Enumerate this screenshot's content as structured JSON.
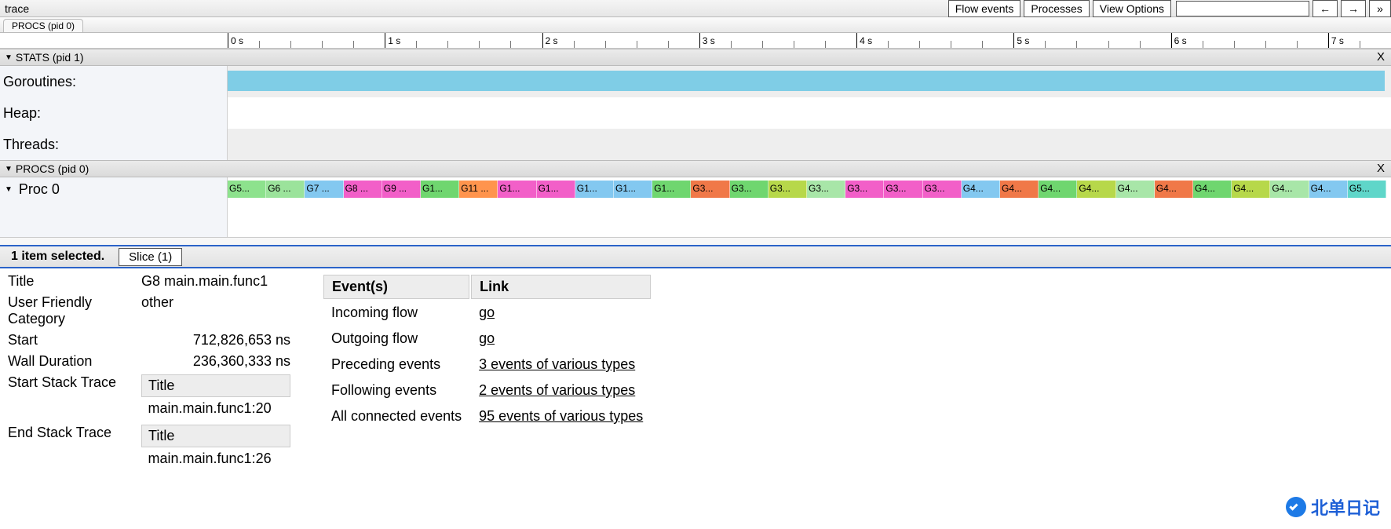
{
  "app_title": "trace",
  "toolbar": {
    "flow_events": "Flow events",
    "processes": "Processes",
    "view_options": "View Options",
    "back": "←",
    "forward": "→",
    "more": "»",
    "search_placeholder": ""
  },
  "tabs": {
    "procs": "PROCS (pid 0)"
  },
  "ruler": {
    "ticks": [
      "0 s",
      "1 s",
      "2 s",
      "3 s",
      "4 s",
      "5 s",
      "6 s",
      "7 s"
    ]
  },
  "stats": {
    "header": "STATS (pid 1)",
    "close": "X",
    "rows": {
      "goroutines": "Goroutines:",
      "heap": "Heap:",
      "threads": "Threads:"
    }
  },
  "procs": {
    "header": "PROCS (pid 0)",
    "close": "X",
    "proc0_label": "Proc 0",
    "slices": [
      {
        "label": "G5...",
        "color": "#8de28d"
      },
      {
        "label": "G6 ...",
        "color": "#9be39b"
      },
      {
        "label": "G7 ...",
        "color": "#83c8f0"
      },
      {
        "label": "G8 ...",
        "color": "#f25fc8"
      },
      {
        "label": "G9 ...",
        "color": "#f25fc8"
      },
      {
        "label": "G1...",
        "color": "#6fd66f"
      },
      {
        "label": "G11 ...",
        "color": "#ff944d"
      },
      {
        "label": "G1...",
        "color": "#f25fc8"
      },
      {
        "label": "G1...",
        "color": "#f25fc8"
      },
      {
        "label": "G1...",
        "color": "#83c8f0"
      },
      {
        "label": "G1...",
        "color": "#83c8f0"
      },
      {
        "label": "G1...",
        "color": "#6fd66f"
      },
      {
        "label": "G3...",
        "color": "#f07848"
      },
      {
        "label": "G3...",
        "color": "#6fd66f"
      },
      {
        "label": "G3...",
        "color": "#b7d84a"
      },
      {
        "label": "G3...",
        "color": "#a8e6a8"
      },
      {
        "label": "G3...",
        "color": "#f25fc8"
      },
      {
        "label": "G3...",
        "color": "#f25fc8"
      },
      {
        "label": "G3...",
        "color": "#f25fc8"
      },
      {
        "label": "G4...",
        "color": "#83c8f0"
      },
      {
        "label": "G4...",
        "color": "#f07848"
      },
      {
        "label": "G4...",
        "color": "#6fd66f"
      },
      {
        "label": "G4...",
        "color": "#b7d84a"
      },
      {
        "label": "G4...",
        "color": "#a8e6a8"
      },
      {
        "label": "G4...",
        "color": "#f07848"
      },
      {
        "label": "G4...",
        "color": "#6fd66f"
      },
      {
        "label": "G4...",
        "color": "#b7d84a"
      },
      {
        "label": "G4...",
        "color": "#a8e6a8"
      },
      {
        "label": "G4...",
        "color": "#83c8f0"
      },
      {
        "label": "G5...",
        "color": "#5fd6c9"
      }
    ]
  },
  "details_bar": {
    "selection": "1 item selected.",
    "slice_btn": "Slice (1)"
  },
  "details": {
    "title_label": "Title",
    "title_value": "G8 main.main.func1",
    "category_label": "User Friendly Category",
    "category_value": "other",
    "start_label": "Start",
    "start_value": "712,826,653 ns",
    "duration_label": "Wall Duration",
    "duration_value": "236,360,333 ns",
    "start_stack_label": "Start Stack Trace",
    "start_stack_th": "Title",
    "start_stack_val": "main.main.func1:20",
    "end_stack_label": "End Stack Trace",
    "end_stack_th": "Title",
    "end_stack_val": "main.main.func1:26"
  },
  "events": {
    "header_event": "Event(s)",
    "header_link": "Link",
    "rows": [
      {
        "k": "Incoming flow",
        "v": "go"
      },
      {
        "k": "Outgoing flow",
        "v": "go"
      },
      {
        "k": "Preceding events",
        "v": "3 events of various types"
      },
      {
        "k": "Following events",
        "v": "2 events of various types"
      },
      {
        "k": "All connected events",
        "v": "95 events of various types"
      }
    ]
  },
  "watermark": "北单日记"
}
